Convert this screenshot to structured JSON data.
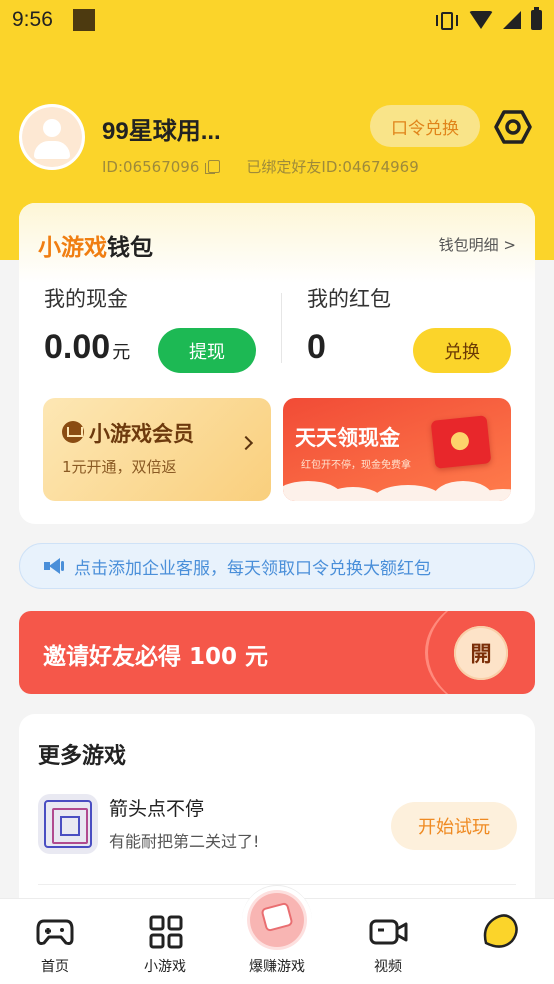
{
  "status_bar": {
    "time": "9:56"
  },
  "profile": {
    "name": "99星球用...",
    "id_text": "ID:06567096",
    "bound_friend": "已绑定好友ID:04674969",
    "code_button": "口令兑换"
  },
  "wallet": {
    "title_orange": "小游戏",
    "title_black": "钱包",
    "detail_link": "钱包明细 >",
    "cash_label": "我的现金",
    "cash_amount": "0.00",
    "cash_unit": "元",
    "withdraw_button": "提现",
    "redpacket_label": "我的红包",
    "redpacket_amount": "0",
    "exchange_button": "兑换",
    "vip_title": "小游戏会员",
    "vip_subtitle": "1元开通，双倍返",
    "daily_cash_title": "天天领现金",
    "daily_cash_subtitle": "红包开不停，现金免费拿"
  },
  "notice": {
    "text": "点击添加企业客服，每天领取口令兑换大额红包"
  },
  "invite": {
    "text": "邀请好友必得 100 元",
    "open_button": "開"
  },
  "more_games": {
    "title": "更多游戏",
    "games": [
      {
        "name": "箭头点不停",
        "desc": "有能耐把第二关过了!",
        "button": "开始试玩"
      }
    ]
  },
  "bottom_nav": {
    "items": [
      {
        "label": "首页",
        "icon": "gamepad-icon"
      },
      {
        "label": "小游戏",
        "icon": "grid-icon"
      },
      {
        "label": "爆赚游戏",
        "icon": "money-icon"
      },
      {
        "label": "视频",
        "icon": "video-camera-icon"
      },
      {
        "label": "",
        "icon": "lemon-icon"
      }
    ]
  },
  "colors": {
    "header_yellow": "#fbd42a",
    "withdraw_green": "#1db954",
    "invite_red": "#f5574a",
    "accent_orange": "#f07e12"
  }
}
